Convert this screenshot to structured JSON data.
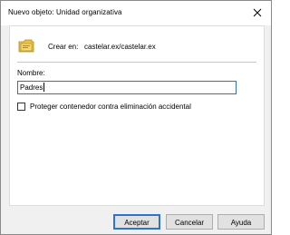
{
  "window": {
    "title": "Nuevo objeto: Unidad organizativa"
  },
  "header": {
    "create_in_label": "Crear en:",
    "create_in_value": "castelar.ex/castelar.ex"
  },
  "form": {
    "name_label": "Nombre:",
    "name_value": "Padres",
    "protect_label": "Proteger contenedor contra eliminación accidental",
    "protect_checked": false
  },
  "buttons": {
    "accept": "Aceptar",
    "cancel": "Cancelar",
    "help": "Ayuda"
  },
  "icons": {
    "close": "close-icon",
    "folder": "organizational-unit-folder-icon"
  },
  "colors": {
    "focus_border": "#3c6fb0",
    "default_button_border": "#2f74c8",
    "dialog_background": "#f0f0f0"
  }
}
